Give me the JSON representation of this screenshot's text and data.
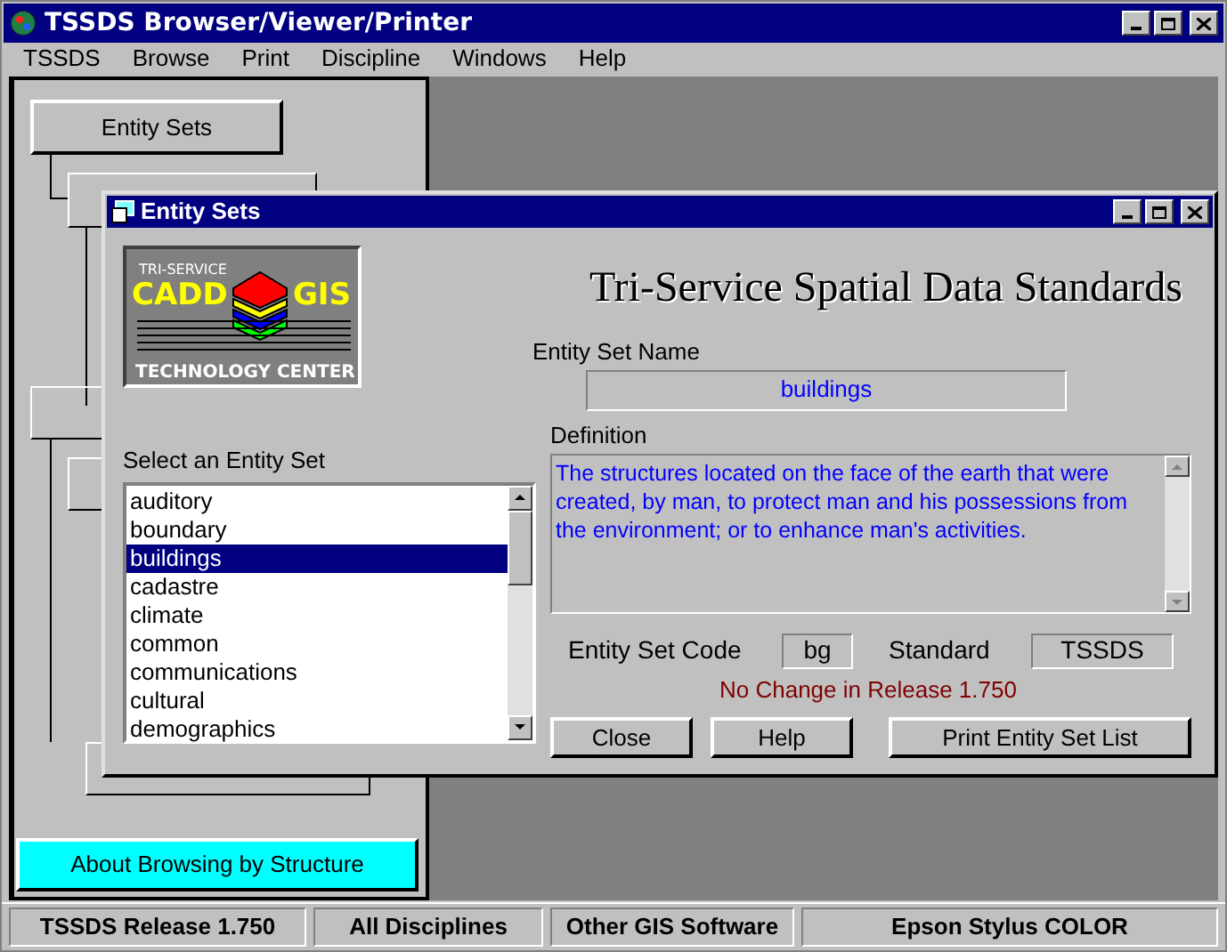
{
  "window": {
    "title": "TSSDS Browser/Viewer/Printer"
  },
  "menu": [
    "TSSDS",
    "Browse",
    "Print",
    "Discipline",
    "Windows",
    "Help"
  ],
  "structure_panel": {
    "root_button": "Entity Sets",
    "about_button": "About Browsing by Structure"
  },
  "dialog": {
    "title": "Entity Sets",
    "logo": {
      "top": "TRI-SERVICE",
      "left": "CADD",
      "right": "GIS",
      "bottom": "TECHNOLOGY CENTER"
    },
    "heading": "Tri-Service Spatial Data Standards",
    "list_label": "Select an Entity Set",
    "entity_sets": [
      {
        "label": "auditory",
        "selected": false
      },
      {
        "label": "boundary",
        "selected": false
      },
      {
        "label": "buildings",
        "selected": true
      },
      {
        "label": "cadastre",
        "selected": false
      },
      {
        "label": "climate",
        "selected": false
      },
      {
        "label": "common",
        "selected": false
      },
      {
        "label": "communications",
        "selected": false
      },
      {
        "label": "cultural",
        "selected": false
      },
      {
        "label": "demographics",
        "selected": false
      }
    ],
    "name_label": "Entity Set Name",
    "name_value": "buildings",
    "definition_label": "Definition",
    "definition": "The structures located on the face of the earth that were created, by man, to protect man and his possessions from the environment; or to enhance man's activities.",
    "code_label": "Entity Set Code",
    "code": "bg",
    "standard_label": "Standard",
    "standard": "TSSDS",
    "release_note": "No Change in Release 1.750",
    "buttons": [
      "Close",
      "Help",
      "Print Entity Set List"
    ]
  },
  "status_bar": [
    "TSSDS Release 1.750",
    "All Disciplines",
    "Other GIS Software",
    "Epson Stylus COLOR"
  ]
}
